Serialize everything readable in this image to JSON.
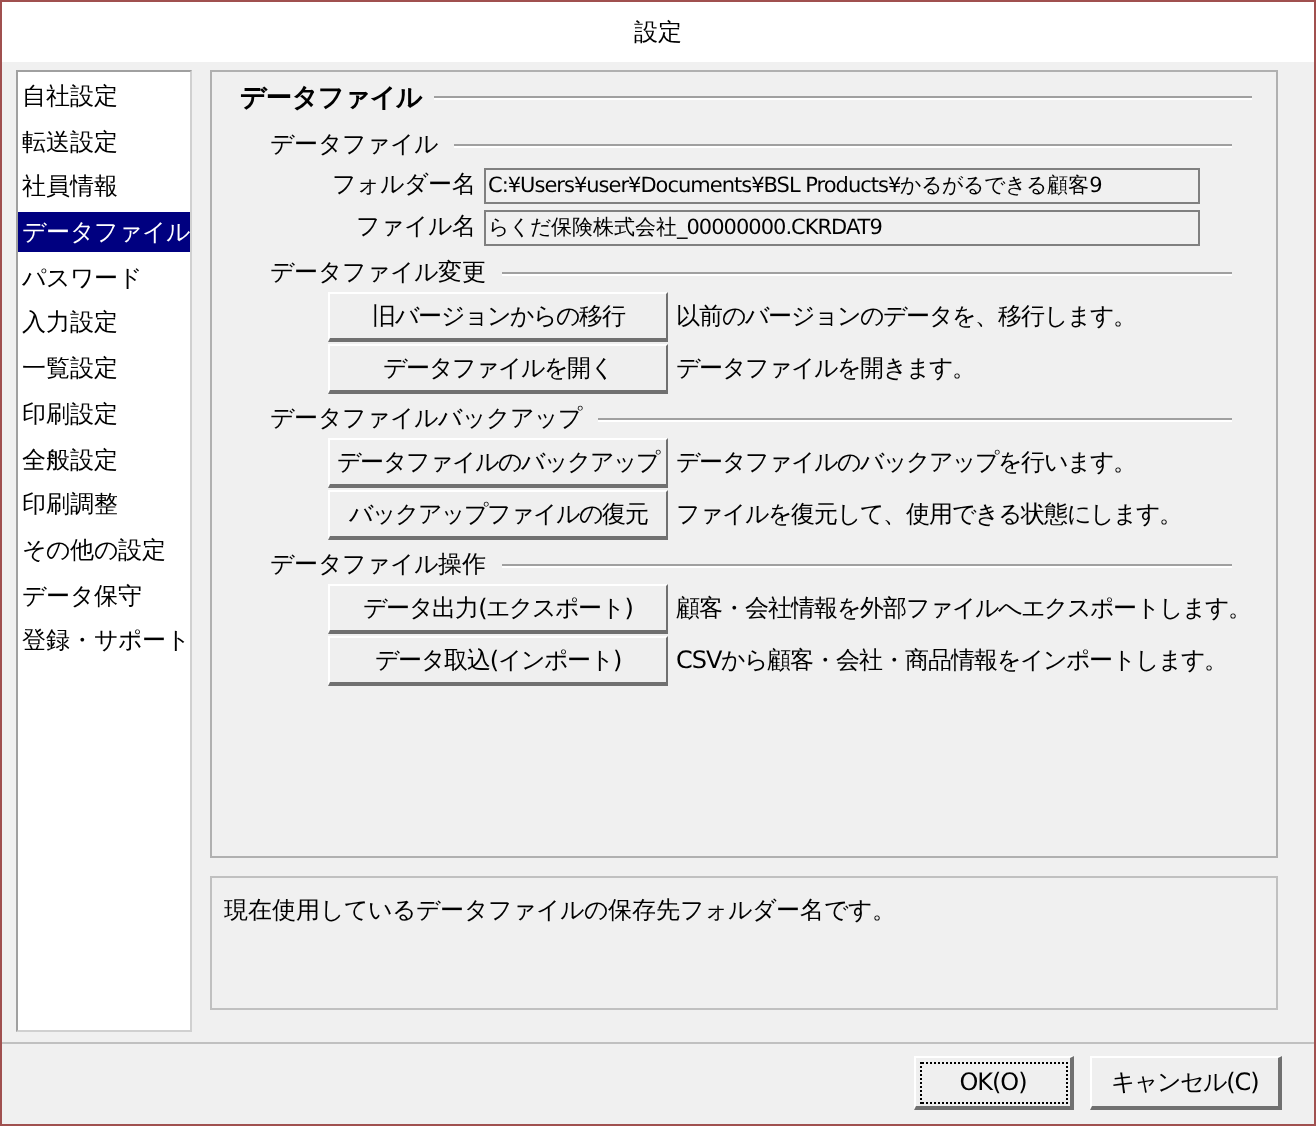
{
  "window": {
    "title": "設定"
  },
  "sidebar": {
    "items": [
      {
        "label": "自社設定",
        "selected": false
      },
      {
        "label": "転送設定",
        "selected": false
      },
      {
        "label": "社員情報",
        "selected": false
      },
      {
        "label": "データファイル",
        "selected": true
      },
      {
        "label": "パスワード",
        "selected": false
      },
      {
        "label": "入力設定",
        "selected": false
      },
      {
        "label": "一覧設定",
        "selected": false
      },
      {
        "label": "印刷設定",
        "selected": false
      },
      {
        "label": "全般設定",
        "selected": false
      },
      {
        "label": "印刷調整",
        "selected": false
      },
      {
        "label": "その他の設定",
        "selected": false
      },
      {
        "label": "データ保守",
        "selected": false
      },
      {
        "label": "登録・サポート",
        "selected": false
      }
    ]
  },
  "panel": {
    "title": "データファイル",
    "sections": [
      {
        "title": "データファイル",
        "rows": [
          {
            "kind": "field",
            "label": "フォルダー名",
            "value": "C:¥Users¥user¥Documents¥BSL Products¥かるがるできる顧客9"
          },
          {
            "kind": "field",
            "label": "ファイル名",
            "value": "らくだ保険株式会社_00000000.CKRDAT9"
          }
        ]
      },
      {
        "title": "データファイル変更",
        "rows": [
          {
            "kind": "button",
            "label": "旧バージョンからの移行",
            "description": "以前のバージョンのデータを、移行します。"
          },
          {
            "kind": "button",
            "label": "データファイルを開く",
            "description": "データファイルを開きます。"
          }
        ]
      },
      {
        "title": "データファイルバックアップ",
        "rows": [
          {
            "kind": "button",
            "label": "データファイルのバックアップ",
            "description": "データファイルのバックアップを行います。"
          },
          {
            "kind": "button",
            "label": "バックアップファイルの復元",
            "description": "ファイルを復元して、使用できる状態にします。"
          }
        ]
      },
      {
        "title": "データファイル操作",
        "rows": [
          {
            "kind": "button",
            "label": "データ出力(エクスポート)",
            "description": "顧客・会社情報を外部ファイルへエクスポートします。"
          },
          {
            "kind": "button",
            "label": "データ取込(インポート)",
            "description": "CSVから顧客・会社・商品情報をインポートします。"
          }
        ]
      }
    ]
  },
  "help_text": "現在使用しているデータファイルの保存先フォルダー名です。",
  "buttons": [
    {
      "label": "OK(O)",
      "focused": true
    },
    {
      "label": "キャンセル(C)",
      "focused": false
    }
  ]
}
